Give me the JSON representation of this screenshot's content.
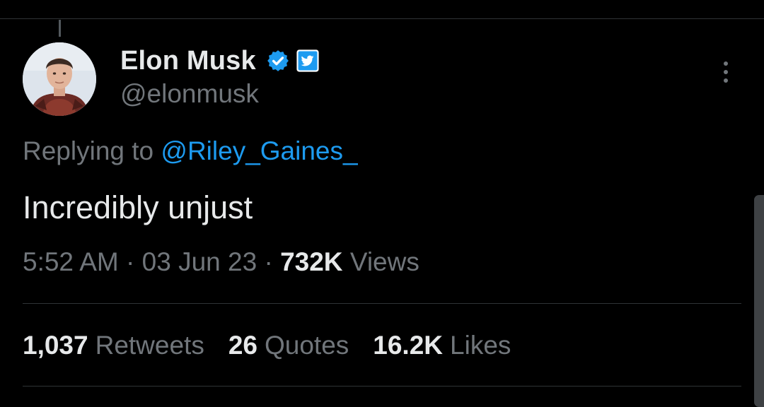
{
  "author": {
    "display_name": "Elon Musk",
    "handle": "@elonmusk"
  },
  "icons": {
    "verified": "verified-badge-icon",
    "affiliate": "twitter-bird-icon",
    "more": "more-vertical-icon"
  },
  "reply": {
    "prefix": "Replying to ",
    "mention": "@Riley_Gaines_"
  },
  "tweet": {
    "text": "Incredibly unjust"
  },
  "meta": {
    "time": "5:52 AM",
    "separator": "·",
    "date": "03 Jun 23",
    "views_count": "732K",
    "views_label": "Views"
  },
  "stats": {
    "retweets_count": "1,037",
    "retweets_label": "Retweets",
    "quotes_count": "26",
    "quotes_label": "Quotes",
    "likes_count": "16.2K",
    "likes_label": "Likes"
  },
  "colors": {
    "background": "#000000",
    "primary_text": "#e7e9ea",
    "secondary_text": "#71767b",
    "accent": "#1d9bf0",
    "divider": "#2f3336"
  }
}
